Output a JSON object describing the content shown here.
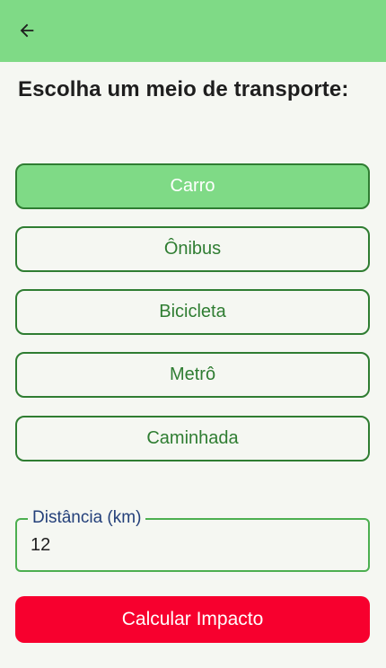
{
  "header": {
    "back_icon": "arrow-left-icon"
  },
  "title": "Escolha um meio de transporte:",
  "options": [
    {
      "label": "Carro",
      "selected": true
    },
    {
      "label": "Ônibus",
      "selected": false
    },
    {
      "label": "Bicicleta",
      "selected": false
    },
    {
      "label": "Metrô",
      "selected": false
    },
    {
      "label": "Caminhada",
      "selected": false
    }
  ],
  "distance": {
    "label": "Distância (km)",
    "value": "12"
  },
  "calculate_label": "Calcular Impacto",
  "colors": {
    "appbar": "#7fda86",
    "accent": "#2f7d32",
    "selected_bg": "#7fda86",
    "button": "#f7002e"
  }
}
